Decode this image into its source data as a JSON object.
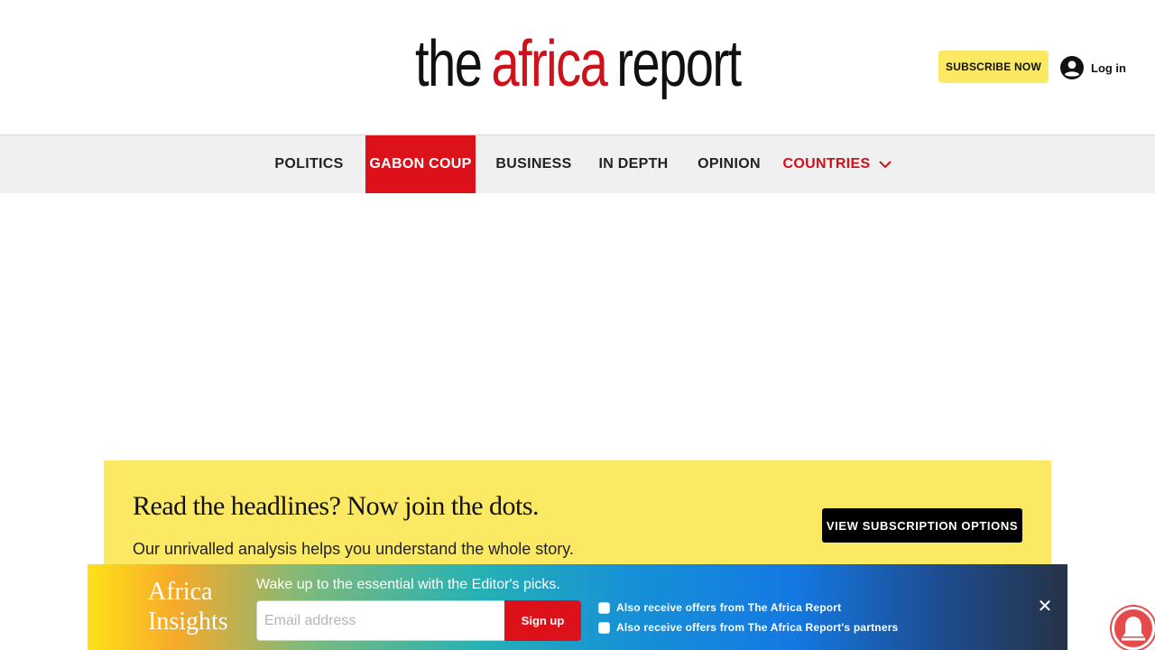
{
  "header": {
    "logo": {
      "part1": "the",
      "part2": "africa",
      "part3": "report"
    },
    "subscribe_label": "SUBSCRIBE NOW",
    "login_label": "Log in"
  },
  "nav": {
    "items": [
      {
        "label": "POLITICS"
      },
      {
        "label": "GABON COUP",
        "active": true
      },
      {
        "label": "BUSINESS"
      },
      {
        "label": "IN DEPTH"
      },
      {
        "label": "OPINION"
      },
      {
        "label": "COUNTRIES"
      }
    ]
  },
  "promo": {
    "title": "Read the headlines? Now join the dots.",
    "subtitle": "Our unrivalled analysis helps you understand the whole story.",
    "button_label": "VIEW SUBSCRIPTION OPTIONS"
  },
  "newsletter": {
    "title_line1": "Africa",
    "title_line2": "Insights",
    "prompt": "Wake up to the essential with the Editor's picks.",
    "email_placeholder": "Email address",
    "signup_label": "Sign up",
    "options": [
      {
        "label": "Also receive offers from The Africa Report",
        "checked": false
      },
      {
        "label": "Also receive offers from The Africa Report's partners",
        "checked": false
      }
    ],
    "close_symbol": "✕"
  },
  "colors": {
    "brand_red": "#dc1119",
    "promo_yellow": "#fbe964",
    "nav_bg": "#f0f0f0"
  }
}
